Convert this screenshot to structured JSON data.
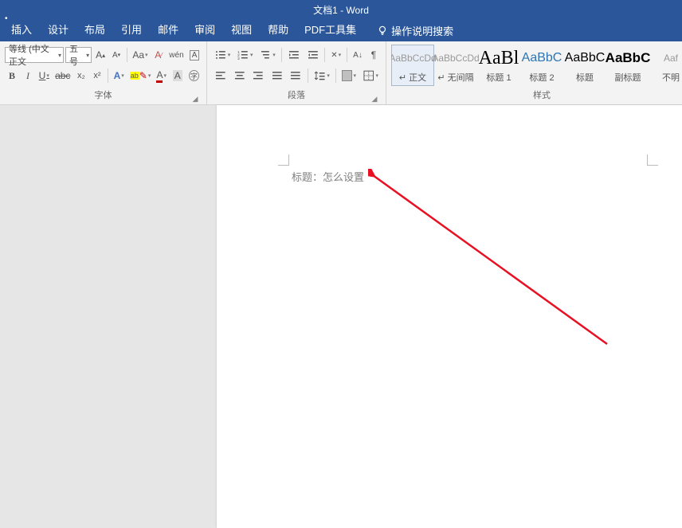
{
  "title": "文档1 - Word",
  "tabs": [
    "插入",
    "设计",
    "布局",
    "引用",
    "邮件",
    "审阅",
    "视图",
    "帮助",
    "PDF工具集"
  ],
  "help_search": "操作说明搜索",
  "font": {
    "family": "等线 (中文正文",
    "size": "五号",
    "inc": "A",
    "dec": "A",
    "phonetic": "Aa",
    "clear": "A",
    "enclosed": "字",
    "bold": "B",
    "italic": "I",
    "underline": "U",
    "strike": "abc",
    "sub": "x₂",
    "sup": "x²",
    "effects": "A",
    "highlight": "ab",
    "color": "A",
    "charshade": "A",
    "border": "⎕",
    "group_label": "字体"
  },
  "para": {
    "group_label": "段落"
  },
  "styles": {
    "group_label": "样式",
    "items": [
      {
        "preview": "AaBbCcDd",
        "name": "↵ 正文",
        "cls": "dim",
        "selected": true
      },
      {
        "preview": "AaBbCcDd",
        "name": "↵ 无间隔",
        "cls": "dim"
      },
      {
        "preview": "AaBl",
        "name": "标题 1",
        "cls": "h1"
      },
      {
        "preview": "AaBbC",
        "name": "标题 2",
        "cls": "h2"
      },
      {
        "preview": "AaBbC",
        "name": "标题",
        "cls": "ttl"
      },
      {
        "preview": "AaBbC",
        "name": "副标题",
        "cls": "sub"
      },
      {
        "preview": "Aaf",
        "name": "不明",
        "cls": "dim"
      }
    ]
  },
  "document": {
    "text": "标题：怎么设置"
  }
}
